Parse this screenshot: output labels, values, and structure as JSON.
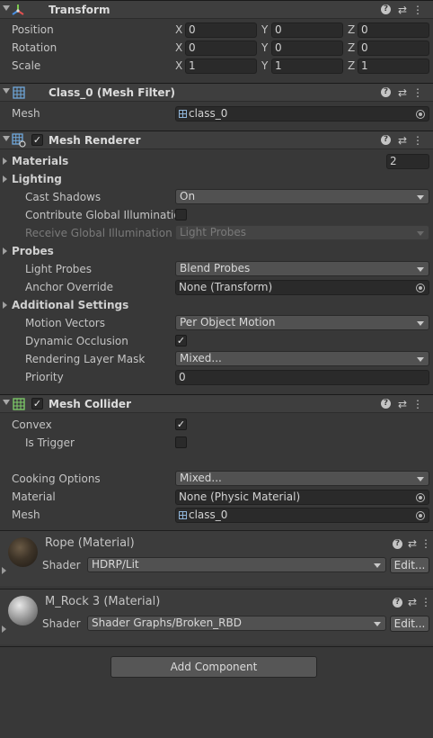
{
  "transform": {
    "title": "Transform",
    "rows": [
      {
        "label": "Position",
        "x": "0",
        "y": "0",
        "z": "0"
      },
      {
        "label": "Rotation",
        "x": "0",
        "y": "0",
        "z": "0"
      },
      {
        "label": "Scale",
        "x": "1",
        "y": "1",
        "z": "1"
      }
    ],
    "axis": {
      "x": "X",
      "y": "Y",
      "z": "Z"
    }
  },
  "mesh_filter": {
    "title": "Class_0 (Mesh Filter)",
    "mesh_label": "Mesh",
    "mesh_value": "class_0"
  },
  "mesh_renderer": {
    "title": "Mesh Renderer",
    "enabled": true,
    "materials_label": "Materials",
    "materials_count": "2",
    "lighting_label": "Lighting",
    "cast_shadows_label": "Cast Shadows",
    "cast_shadows_value": "On",
    "contribute_gi_label": "Contribute Global Illumination",
    "contribute_gi": false,
    "receive_gi_label": "Receive Global Illumination",
    "receive_gi_value": "Light Probes",
    "probes_label": "Probes",
    "light_probes_label": "Light Probes",
    "light_probes_value": "Blend Probes",
    "anchor_override_label": "Anchor Override",
    "anchor_override_value": "None (Transform)",
    "additional_label": "Additional Settings",
    "motion_vectors_label": "Motion Vectors",
    "motion_vectors_value": "Per Object Motion",
    "dynamic_occlusion_label": "Dynamic Occlusion",
    "dynamic_occlusion": true,
    "rendering_layer_label": "Rendering Layer Mask",
    "rendering_layer_value": "Mixed...",
    "priority_label": "Priority",
    "priority_value": "0"
  },
  "mesh_collider": {
    "title": "Mesh Collider",
    "enabled": true,
    "convex_label": "Convex",
    "convex": true,
    "is_trigger_label": "Is Trigger",
    "is_trigger": false,
    "cooking_label": "Cooking Options",
    "cooking_value": "Mixed...",
    "material_label": "Material",
    "material_value": "None (Physic Material)",
    "mesh_label": "Mesh",
    "mesh_value": "class_0"
  },
  "materials": [
    {
      "title": "Rope (Material)",
      "shader_label": "Shader",
      "shader_value": "HDRP/Lit",
      "edit_label": "Edit..."
    },
    {
      "title": "M_Rock 3 (Material)",
      "shader_label": "Shader",
      "shader_value": "Shader Graphs/Broken_RBD",
      "edit_label": "Edit..."
    }
  ],
  "footer": {
    "add_component_label": "Add Component"
  },
  "glyphs": {
    "help": "?",
    "presets": "⇄",
    "menu": "⋮",
    "check": "✓"
  },
  "colors": {
    "background": "#383838",
    "header": "#3e3e3e",
    "field": "#2a2a2a",
    "dropdown": "#515151"
  }
}
